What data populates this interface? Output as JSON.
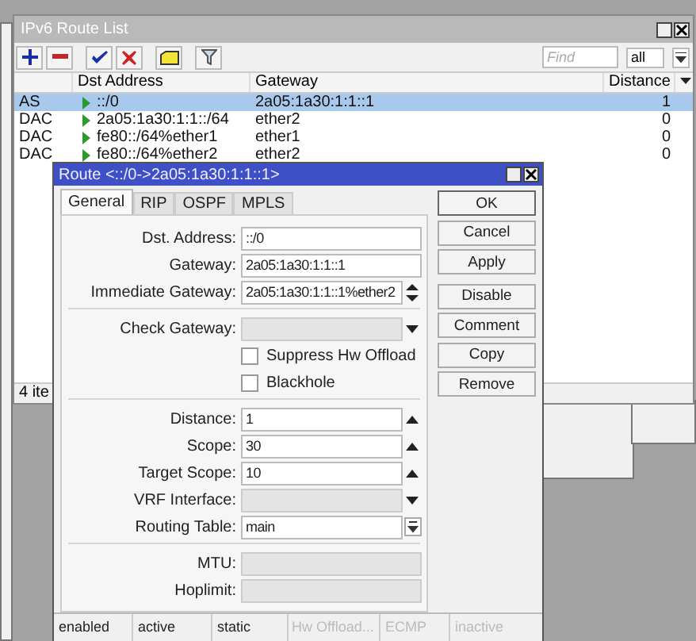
{
  "route_list": {
    "title": "IPv6 Route List",
    "toolbar": [
      {
        "kind": "add"
      },
      {
        "kind": "remove"
      },
      {
        "kind": "enable"
      },
      {
        "kind": "disable"
      },
      {
        "kind": "comment"
      },
      {
        "kind": "filter"
      }
    ],
    "find": {
      "placeholder": "Find"
    },
    "filter": "all",
    "columns": [
      {
        "label": "Dst Address"
      },
      {
        "label": "Gateway"
      },
      {
        "label": "Distance"
      }
    ],
    "rows": [
      {
        "flags": "AS",
        "dst_address": "::/0",
        "gateway": "2a05:1a30:1:1::1",
        "distance": "1",
        "selected": true
      },
      {
        "flags": "DAC",
        "dst_address": "2a05:1a30:1:1::/64",
        "gateway": "ether2",
        "distance": "0",
        "selected": false
      },
      {
        "flags": "DAC",
        "dst_address": "fe80::/64%ether1",
        "gateway": "ether1",
        "distance": "0",
        "selected": false
      },
      {
        "flags": "DAC",
        "dst_address": "fe80::/64%ether2",
        "gateway": "ether2",
        "distance": "0",
        "selected": false
      }
    ],
    "status": "4 ite"
  },
  "route_dialog": {
    "title": "Route <::/0->2a05:1a30:1:1::1>",
    "tabs": [
      {
        "label": "General",
        "selected": true
      },
      {
        "label": "RIP",
        "selected": false
      },
      {
        "label": "OSPF",
        "selected": false
      },
      {
        "label": "MPLS",
        "selected": false
      }
    ],
    "sections": [
      [
        {
          "kind": "text",
          "label": "Dst. Address:",
          "value": "::/0",
          "disabled": false
        },
        {
          "kind": "text",
          "label": "Gateway:",
          "value": "2a05:1a30:1:1::1",
          "disabled": false
        },
        {
          "kind": "updown",
          "label": "Immediate Gateway:",
          "value": "2a05:1a30:1:1::1%ether2",
          "disabled": false
        }
      ],
      [
        {
          "kind": "dropdown",
          "label": "Check Gateway:",
          "disabled": true
        },
        {
          "kind": "checkbox",
          "label": "Suppress Hw Offload",
          "checked": false
        },
        {
          "kind": "checkbox",
          "label": "Blackhole",
          "checked": false
        }
      ],
      [
        {
          "kind": "up",
          "label": "Distance:",
          "value": "1",
          "disabled": false
        },
        {
          "kind": "up",
          "label": "Scope:",
          "value": "30",
          "disabled": false
        },
        {
          "kind": "up",
          "label": "Target Scope:",
          "value": "10",
          "disabled": false
        },
        {
          "kind": "dropdown",
          "label": "VRF Interface:",
          "disabled": true
        },
        {
          "kind": "select",
          "label": "Routing Table:",
          "value": "main",
          "disabled": false
        }
      ],
      [
        {
          "kind": "text",
          "label": "MTU:",
          "disabled": true
        },
        {
          "kind": "text",
          "label": "Hoplimit:",
          "disabled": true
        }
      ]
    ],
    "button_groups": [
      [
        {
          "label": "OK"
        },
        {
          "label": "Cancel"
        },
        {
          "label": "Apply"
        }
      ],
      [
        {
          "label": "Disable"
        },
        {
          "label": "Comment"
        },
        {
          "label": "Copy"
        },
        {
          "label": "Remove"
        }
      ]
    ],
    "status": [
      {
        "text": "enabled",
        "disabled": false
      },
      {
        "text": "active",
        "disabled": false
      },
      {
        "text": "static",
        "disabled": false
      },
      {
        "text": "Hw Offload...",
        "disabled": true
      },
      {
        "text": "ECMP",
        "disabled": true
      },
      {
        "text": "inactive",
        "disabled": true
      }
    ]
  }
}
